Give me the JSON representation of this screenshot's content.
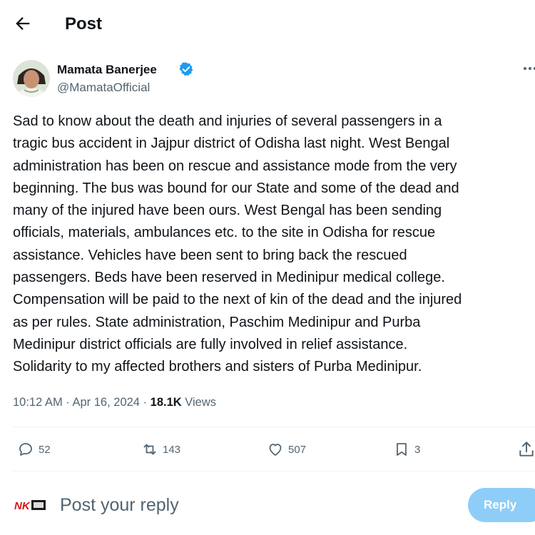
{
  "header": {
    "title": "Post",
    "back_icon": "arrow-left-icon"
  },
  "author": {
    "name": "Mamata Banerjee",
    "handle": "@MamataOfficial",
    "verified": true,
    "verified_color": "#1d9bf0"
  },
  "post": {
    "lines": [
      "Sad to know about the death and injuries of several passengers in a",
      "tragic bus accident in Jajpur district of Odisha last night. West Bengal",
      "administration has been on rescue and assistance mode from the very",
      "beginning. The bus was bound for our State and some of the dead and",
      "many of the injured have been ours. West Bengal has been sending",
      "officials, materials, ambulances etc. to the site in Odisha for rescue",
      "assistance. Vehicles have been sent to bring back the rescued",
      "passengers. Beds have been reserved in Medinipur medical college.",
      "Compensation will be paid to the next of kin of the dead and the injured",
      "as per rules. State administration, Paschim Medinipur and Purba",
      "Medinipur district officials are fully involved in relief assistance.",
      "Solidarity to my affected brothers and sisters of Purba Medinipur."
    ],
    "time": "10:12 AM",
    "date": "Apr 16, 2024",
    "separator": " · ",
    "views_count": "18.1K",
    "views_label": " Views"
  },
  "actions": {
    "replies": "52",
    "reposts": "143",
    "likes": "507",
    "bookmarks": "3"
  },
  "reply": {
    "avatar_text": "NK",
    "placeholder": "Post your reply",
    "button_label": "Reply"
  },
  "colors": {
    "text": "#0f1419",
    "secondary": "#536471",
    "reply_button": "#8ecdf8",
    "divider": "#eff3f4"
  }
}
